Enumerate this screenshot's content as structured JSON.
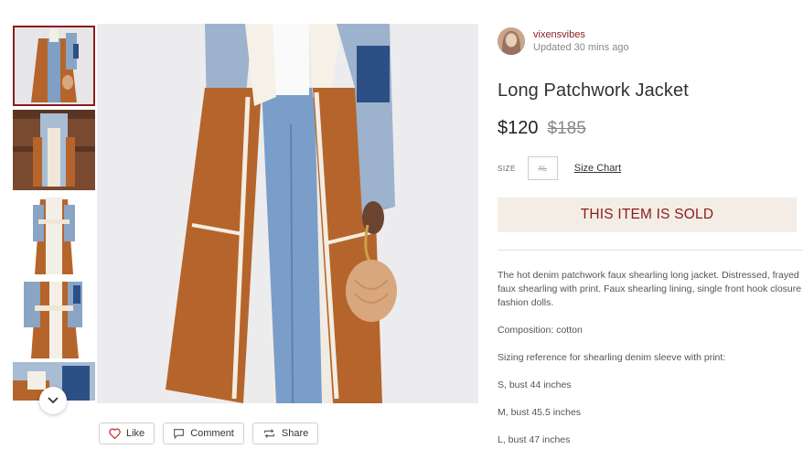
{
  "seller": {
    "name": "vixensvibes",
    "updated": "Updated 30 mins ago"
  },
  "product": {
    "title": "Long Patchwork Jacket",
    "price": "$120",
    "original_price": "$185",
    "size_label": "SIZE",
    "size_value": "XL",
    "size_chart": "Size Chart",
    "sold_banner": "THIS ITEM IS SOLD"
  },
  "description": {
    "paragraph_lines": [
      "The hot denim patchwork faux shearling long jacket. Distressed, frayed",
      "faux shearling with print. Faux shearling lining, single front hook closure",
      "fashion dolls."
    ],
    "composition": "Composition: cotton",
    "sizing_intro": "Sizing reference for shearling denim sleeve with print:",
    "sizes": [
      "S, bust 44 inches",
      "M, bust 45.5 inches",
      "L, bust 47 inches"
    ]
  },
  "actions": {
    "like": "Like",
    "comment": "Comment",
    "share": "Share"
  },
  "gallery": {
    "thumb_count": 5,
    "selected_index": 0
  },
  "colors": {
    "accent": "#8b1c1c",
    "sold_bg": "#f3ede6",
    "suede": "#b5652b",
    "denim": "#7f9fc4",
    "shearling": "#f4efe6"
  },
  "icons": {
    "like": "heart-icon",
    "comment": "comment-icon",
    "share": "repost-icon",
    "scroll": "chevron-down-icon"
  }
}
